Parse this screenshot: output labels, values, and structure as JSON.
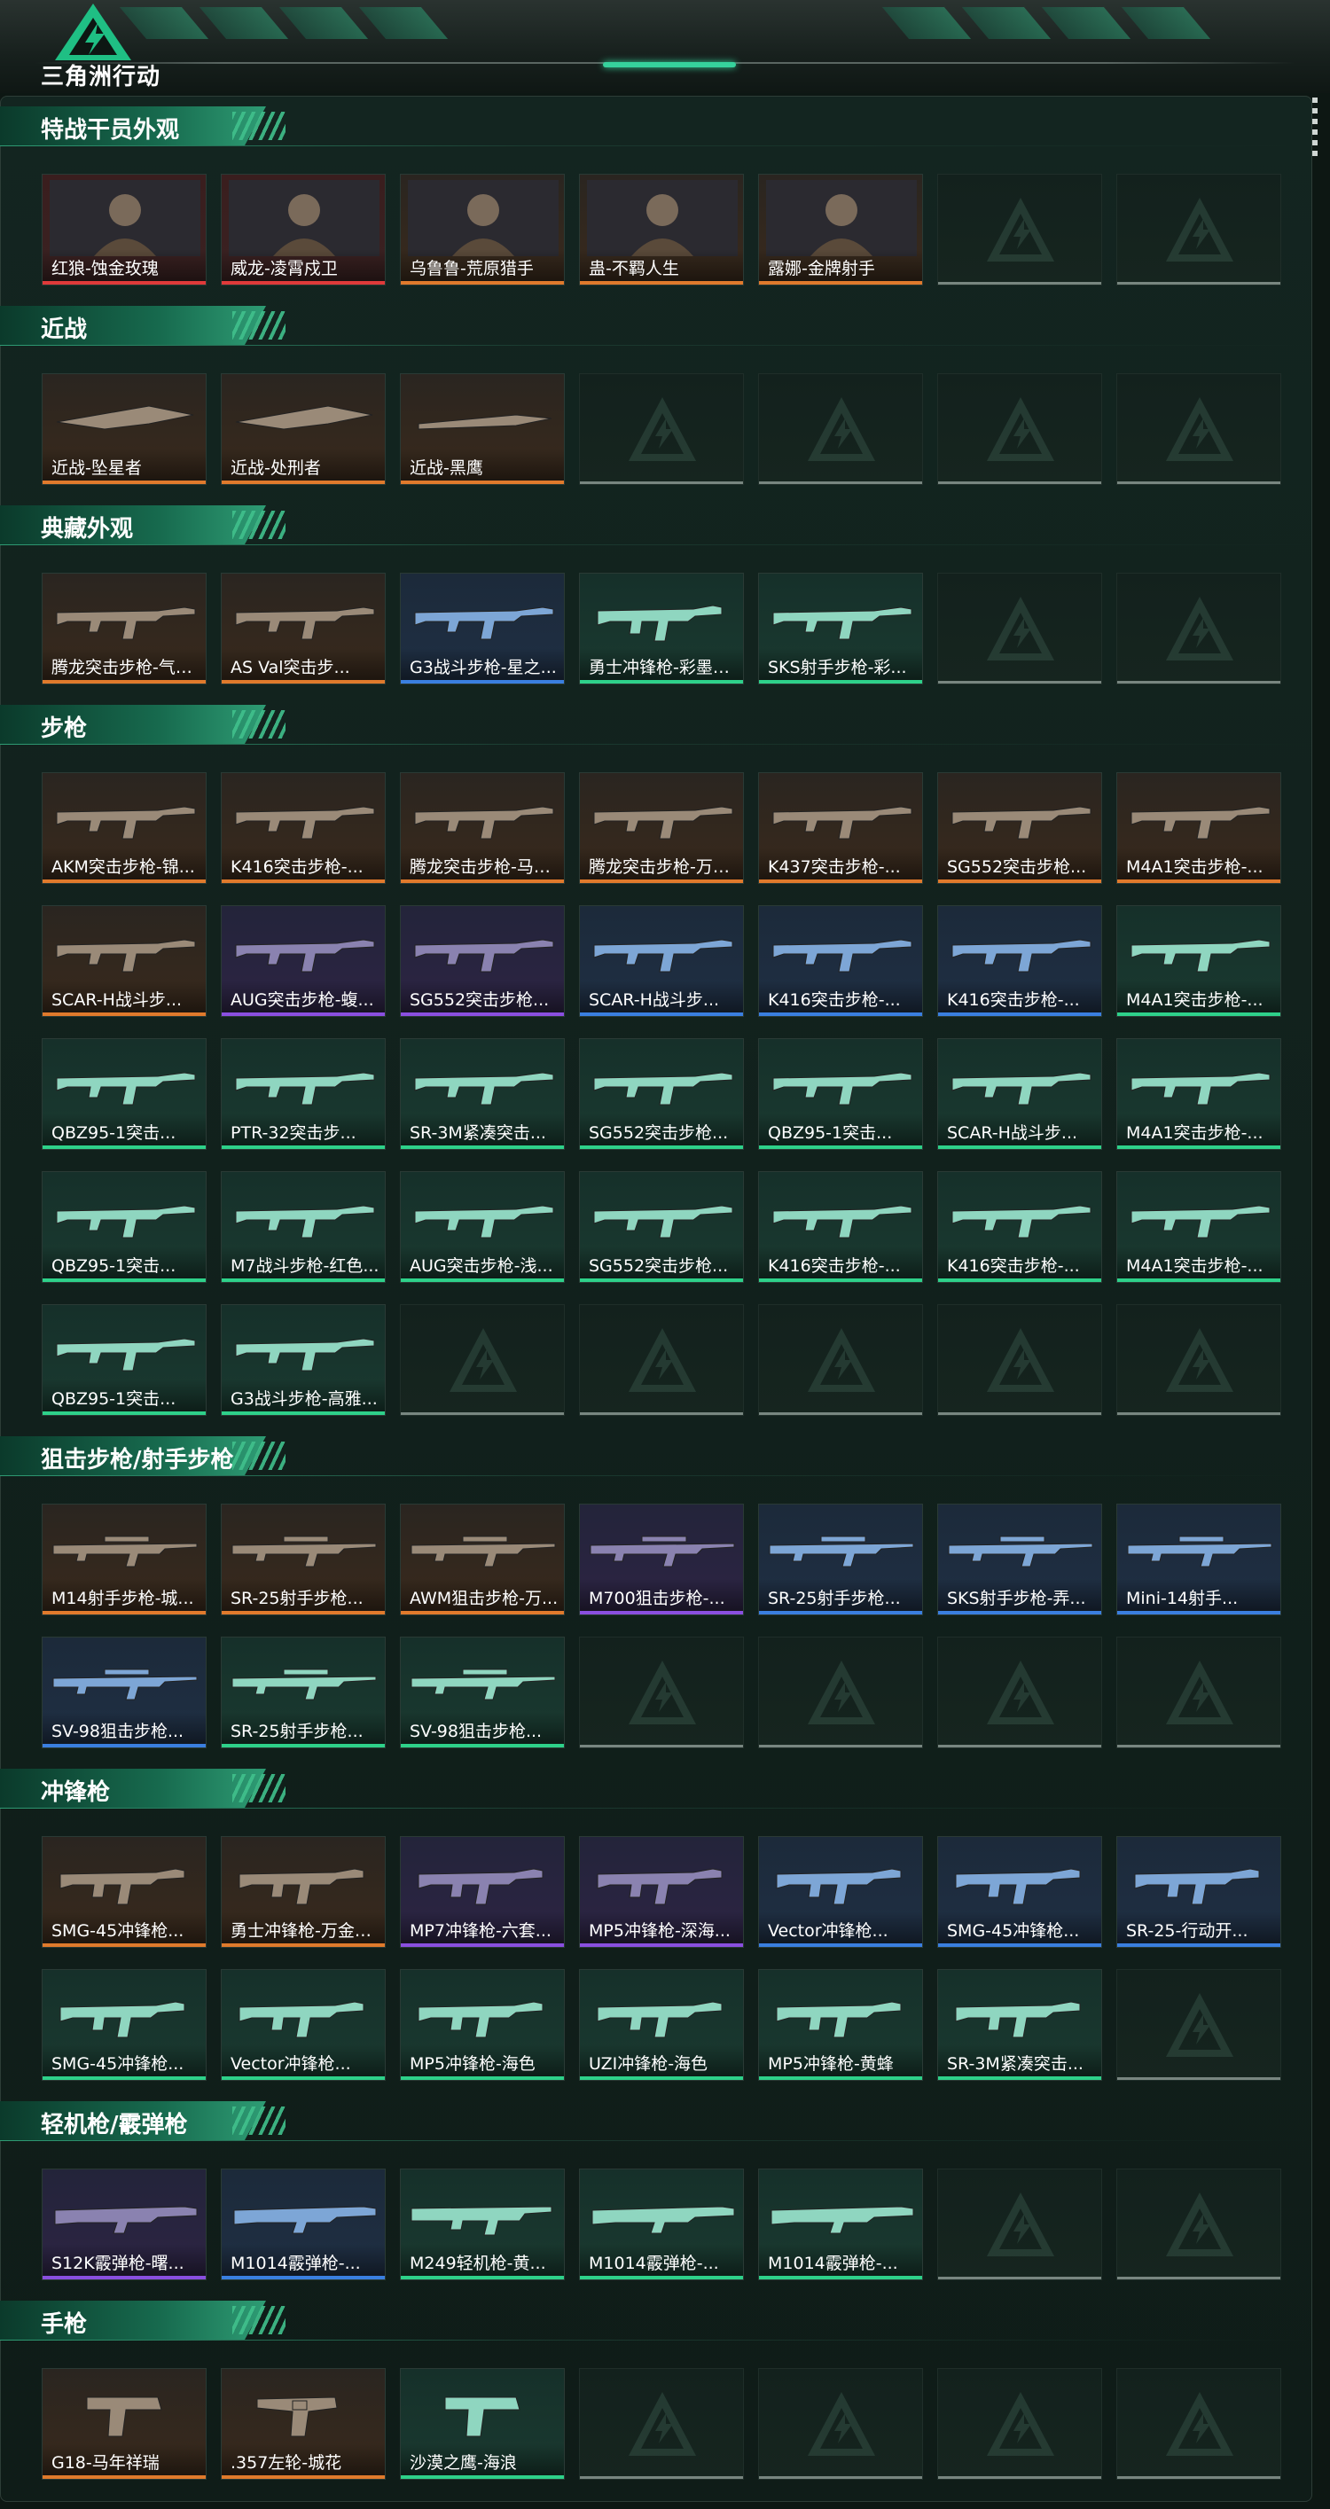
{
  "app": {
    "brand": "三角洲行动"
  },
  "sections": [
    {
      "title": "特战干员外观",
      "cards": [
        {
          "label": "红狼-蚀金玫瑰",
          "rarity": "red",
          "icon": "operator-portrait"
        },
        {
          "label": "威龙-凌霄戍卫",
          "rarity": "red",
          "icon": "operator-portrait"
        },
        {
          "label": "乌鲁鲁-荒原猎手",
          "rarity": "orange",
          "icon": "operator-portrait"
        },
        {
          "label": "蛊-不羁人生",
          "rarity": "orange",
          "icon": "operator-portrait"
        },
        {
          "label": "露娜-金牌射手",
          "rarity": "orange",
          "icon": "operator-portrait"
        }
      ],
      "slots": 7
    },
    {
      "title": "近战",
      "cards": [
        {
          "label": "近战-坠星者",
          "rarity": "orange",
          "icon": "melee-blade"
        },
        {
          "label": "近战-处刑者",
          "rarity": "orange",
          "icon": "melee-blade"
        },
        {
          "label": "近战-黑鹰",
          "rarity": "orange",
          "icon": "melee-knife"
        }
      ],
      "slots": 7
    },
    {
      "title": "典藏外观",
      "cards": [
        {
          "label": "腾龙突击步枪-气象...",
          "rarity": "orange",
          "icon": "rifle"
        },
        {
          "label": "AS Val突击步...",
          "rarity": "orange",
          "icon": "rifle"
        },
        {
          "label": "G3战斗步枪-星之...",
          "rarity": "blue",
          "icon": "rifle"
        },
        {
          "label": "勇士冲锋枪-彩墨涂...",
          "rarity": "green",
          "icon": "smg"
        },
        {
          "label": "SKS射手步枪-彩...",
          "rarity": "green",
          "icon": "rifle"
        }
      ],
      "slots": 7
    },
    {
      "title": "步枪",
      "cards": [
        {
          "label": "AKM突击步枪-锦...",
          "rarity": "orange",
          "icon": "rifle"
        },
        {
          "label": "K416突击步枪-...",
          "rarity": "orange",
          "icon": "rifle"
        },
        {
          "label": "腾龙突击步枪-马年...",
          "rarity": "orange",
          "icon": "rifle"
        },
        {
          "label": "腾龙突击步枪-万金...",
          "rarity": "orange",
          "icon": "rifle"
        },
        {
          "label": "K437突击步枪-...",
          "rarity": "orange",
          "icon": "rifle"
        },
        {
          "label": "SG552突击步枪...",
          "rarity": "orange",
          "icon": "rifle"
        },
        {
          "label": "M4A1突击步枪-...",
          "rarity": "orange",
          "icon": "rifle"
        },
        {
          "label": "SCAR-H战斗步...",
          "rarity": "orange",
          "icon": "rifle"
        },
        {
          "label": "AUG突击步枪-蝮...",
          "rarity": "purple",
          "icon": "rifle"
        },
        {
          "label": "SG552突击步枪...",
          "rarity": "purple",
          "icon": "rifle"
        },
        {
          "label": "SCAR-H战斗步...",
          "rarity": "blue",
          "icon": "rifle"
        },
        {
          "label": "K416突击步枪-...",
          "rarity": "blue",
          "icon": "rifle"
        },
        {
          "label": "K416突击步枪-...",
          "rarity": "blue",
          "icon": "rifle"
        },
        {
          "label": "M4A1突击步枪-...",
          "rarity": "green",
          "icon": "rifle"
        },
        {
          "label": "QBZ95-1突击...",
          "rarity": "green",
          "icon": "rifle"
        },
        {
          "label": "PTR-32突击步...",
          "rarity": "green",
          "icon": "rifle"
        },
        {
          "label": "SR-3M紧凑突击...",
          "rarity": "green",
          "icon": "rifle"
        },
        {
          "label": "SG552突击步枪...",
          "rarity": "green",
          "icon": "rifle"
        },
        {
          "label": "QBZ95-1突击...",
          "rarity": "green",
          "icon": "rifle"
        },
        {
          "label": "SCAR-H战斗步...",
          "rarity": "green",
          "icon": "rifle"
        },
        {
          "label": "M4A1突击步枪-...",
          "rarity": "green",
          "icon": "rifle"
        },
        {
          "label": "QBZ95-1突击...",
          "rarity": "green",
          "icon": "rifle"
        },
        {
          "label": "M7战斗步枪-红色...",
          "rarity": "green",
          "icon": "rifle"
        },
        {
          "label": "AUG突击步枪-浅...",
          "rarity": "green",
          "icon": "rifle"
        },
        {
          "label": "SG552突击步枪...",
          "rarity": "green",
          "icon": "rifle"
        },
        {
          "label": "K416突击步枪-...",
          "rarity": "green",
          "icon": "rifle"
        },
        {
          "label": "K416突击步枪-...",
          "rarity": "green",
          "icon": "rifle"
        },
        {
          "label": "M4A1突击步枪-...",
          "rarity": "green",
          "icon": "rifle"
        },
        {
          "label": "QBZ95-1突击...",
          "rarity": "green",
          "icon": "rifle"
        },
        {
          "label": "G3战斗步枪-高雅...",
          "rarity": "green",
          "icon": "rifle"
        }
      ],
      "slots": 35
    },
    {
      "title": "狙击步枪/射手步枪",
      "cards": [
        {
          "label": "M14射手步枪-城...",
          "rarity": "orange",
          "icon": "sniper"
        },
        {
          "label": "SR-25射手步枪...",
          "rarity": "orange",
          "icon": "sniper"
        },
        {
          "label": "AWM狙击步枪-万...",
          "rarity": "orange",
          "icon": "sniper"
        },
        {
          "label": "M700狙击步枪-...",
          "rarity": "purple",
          "icon": "sniper"
        },
        {
          "label": "SR-25射手步枪...",
          "rarity": "blue",
          "icon": "sniper"
        },
        {
          "label": "SKS射手步枪-弄...",
          "rarity": "blue",
          "icon": "sniper"
        },
        {
          "label": "Mini-14射手...",
          "rarity": "blue",
          "icon": "sniper"
        },
        {
          "label": "SV-98狙击步枪...",
          "rarity": "blue",
          "icon": "sniper"
        },
        {
          "label": "SR-25射手步枪...",
          "rarity": "green",
          "icon": "sniper"
        },
        {
          "label": "SV-98狙击步枪...",
          "rarity": "green",
          "icon": "sniper"
        }
      ],
      "slots": 14
    },
    {
      "title": "冲锋枪",
      "cards": [
        {
          "label": "SMG-45冲锋枪...",
          "rarity": "orange",
          "icon": "smg"
        },
        {
          "label": "勇士冲锋枪-万金泪...",
          "rarity": "orange",
          "icon": "smg"
        },
        {
          "label": "MP7冲锋枪-六套...",
          "rarity": "purple",
          "icon": "smg"
        },
        {
          "label": "MP5冲锋枪-深海...",
          "rarity": "purple",
          "icon": "smg"
        },
        {
          "label": "Vector冲锋枪...",
          "rarity": "blue",
          "icon": "smg"
        },
        {
          "label": "SMG-45冲锋枪...",
          "rarity": "blue",
          "icon": "smg"
        },
        {
          "label": "SR-25-行动开...",
          "rarity": "blue",
          "icon": "smg"
        },
        {
          "label": "SMG-45冲锋枪...",
          "rarity": "green",
          "icon": "smg"
        },
        {
          "label": "Vector冲锋枪...",
          "rarity": "green",
          "icon": "smg"
        },
        {
          "label": "MP5冲锋枪-海色",
          "rarity": "green",
          "icon": "smg"
        },
        {
          "label": "UZI冲锋枪-海色",
          "rarity": "green",
          "icon": "smg"
        },
        {
          "label": "MP5冲锋枪-黄蜂",
          "rarity": "green",
          "icon": "smg"
        },
        {
          "label": "SR-3M紧凑突击...",
          "rarity": "green",
          "icon": "smg"
        }
      ],
      "slots": 14
    },
    {
      "title": "轻机枪/霰弹枪",
      "cards": [
        {
          "label": "S12K霰弹枪-曙...",
          "rarity": "purple",
          "icon": "shotgun"
        },
        {
          "label": "M1014霰弹枪-...",
          "rarity": "blue",
          "icon": "shotgun"
        },
        {
          "label": "M249轻机枪-黄...",
          "rarity": "green",
          "icon": "lmg"
        },
        {
          "label": "M1014霰弹枪-...",
          "rarity": "green",
          "icon": "shotgun"
        },
        {
          "label": "M1014霰弹枪-...",
          "rarity": "green",
          "icon": "shotgun"
        }
      ],
      "slots": 7
    },
    {
      "title": "手枪",
      "cards": [
        {
          "label": "G18-马年祥瑞",
          "rarity": "orange",
          "icon": "pistol"
        },
        {
          "label": ".357左轮-城花",
          "rarity": "orange",
          "icon": "revolver"
        },
        {
          "label": "沙漠之鹰-海浪",
          "rarity": "green",
          "icon": "pistol"
        }
      ],
      "slots": 7
    }
  ],
  "colors": {
    "orange": "#e07a2c",
    "purple": "#8a4fe0",
    "blue": "#3a7fe0",
    "green": "#2ed18a",
    "red": "#e03a3a",
    "accent": "#2e9c74"
  }
}
